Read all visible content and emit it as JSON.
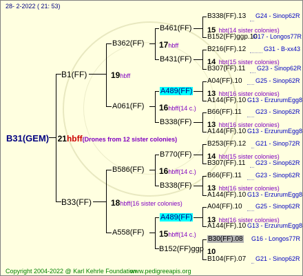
{
  "header": {
    "date": "28-  2-2022 ( 21: 53)"
  },
  "footer": {
    "copyright": "Copyright 2004-2022 @ Karl Kehrle Foundation",
    "site": "www.pedigreeapis.org"
  },
  "root": {
    "name": "B31(GEM)",
    "year": "21",
    "hbff": "hbff",
    "note": "(Drones from 12 sister colonies)"
  },
  "gen1": [
    {
      "name": "B1(FF)",
      "year": "19",
      "hbff": "hbff",
      "note": ""
    },
    {
      "name": "B33(FF)",
      "year": "18",
      "hbff": "hbff",
      "note": "(16 sister colonies)"
    }
  ],
  "gen2": [
    {
      "name": "B362(FF)",
      "year": "17",
      "hbff": "hbff",
      "note": ""
    },
    {
      "name": "A061(FF)",
      "year": "16",
      "hbff": "hbff",
      "note": "(14 c.)"
    },
    {
      "name": "B586(FF)",
      "year": "16",
      "hbff": "hbff",
      "note": "(14 c.)"
    },
    {
      "name": "A558(FF)",
      "year": "15",
      "hbff": "hbff",
      "note": "(14 c.)"
    }
  ],
  "gen3": [
    {
      "name": "B461(FF)",
      "year": "15",
      "hbff": "hbt",
      "note": "(14 sister colonies)"
    },
    {
      "name": "B431(FF)",
      "year": "14",
      "hbff": "hbt",
      "note": "(15 sister colonies)"
    },
    {
      "name": "A489(FF)",
      "year": "13",
      "hbff": "hbt",
      "note": "(16 sister colonies)"
    },
    {
      "name": "B338(FF)",
      "year": "13",
      "hbff": "hbt",
      "note": "(16 sister colonies)"
    },
    {
      "name": "B770(FF)",
      "year": "14",
      "hbff": "hbt",
      "note": "(15 sister colonies)"
    },
    {
      "name": "B338(FF)",
      "year": "13",
      "hbff": "hbt",
      "note": "(16 sister colonies)"
    },
    {
      "name": "A489(FF)",
      "year": "13",
      "hbff": "hbt",
      "note": "(16 sister colonies)"
    },
    {
      "name": "B152(FF)ggp",
      "year": "10",
      "hbff": "",
      "note": ""
    }
  ],
  "gen4": [
    {
      "name": "B338(FF).13",
      "marker": "G24 - Sinop62R"
    },
    {
      "name": "B152(FF)ggp.10",
      "marker": "G17 - Longos77R"
    },
    {
      "name": "B216(FF).12",
      "marker": "G31 - B-xx43"
    },
    {
      "name": "B307(FF).11",
      "marker": "G23 - Sinop62R"
    },
    {
      "name": "A04(FF).10",
      "marker": "G25 - Sinop62R"
    },
    {
      "name": "A144(FF).10",
      "marker": "G13 - ErzurumEgg8"
    },
    {
      "name": "B66(FF).11",
      "marker": "G23 - Sinop62R"
    },
    {
      "name": "A144(FF).10",
      "marker": "G13 - ErzurumEgg8"
    },
    {
      "name": "B253(FF).12",
      "marker": "G21 - Sinop72R"
    },
    {
      "name": "B307(FF).11",
      "marker": "G23 - Sinop62R"
    },
    {
      "name": "B66(FF).11",
      "marker": "G23 - Sinop62R"
    },
    {
      "name": "A144(FF).10",
      "marker": "G13 - ErzurumEgg8"
    },
    {
      "name": "A04(FF).10",
      "marker": "G25 - Sinop62R"
    },
    {
      "name": "A144(FF).10",
      "marker": "G13 - ErzurumEgg8"
    },
    {
      "name": "B30(FF).08",
      "marker": "G16 - Longos77R"
    },
    {
      "name": "B104(FF).07",
      "marker": "G21 - Sinop62R"
    }
  ],
  "colors": {
    "background": "#ffffe0",
    "accent": "#000080",
    "highlight": "#00ffff",
    "hbff": "#cc0000",
    "footer": "#008000"
  }
}
